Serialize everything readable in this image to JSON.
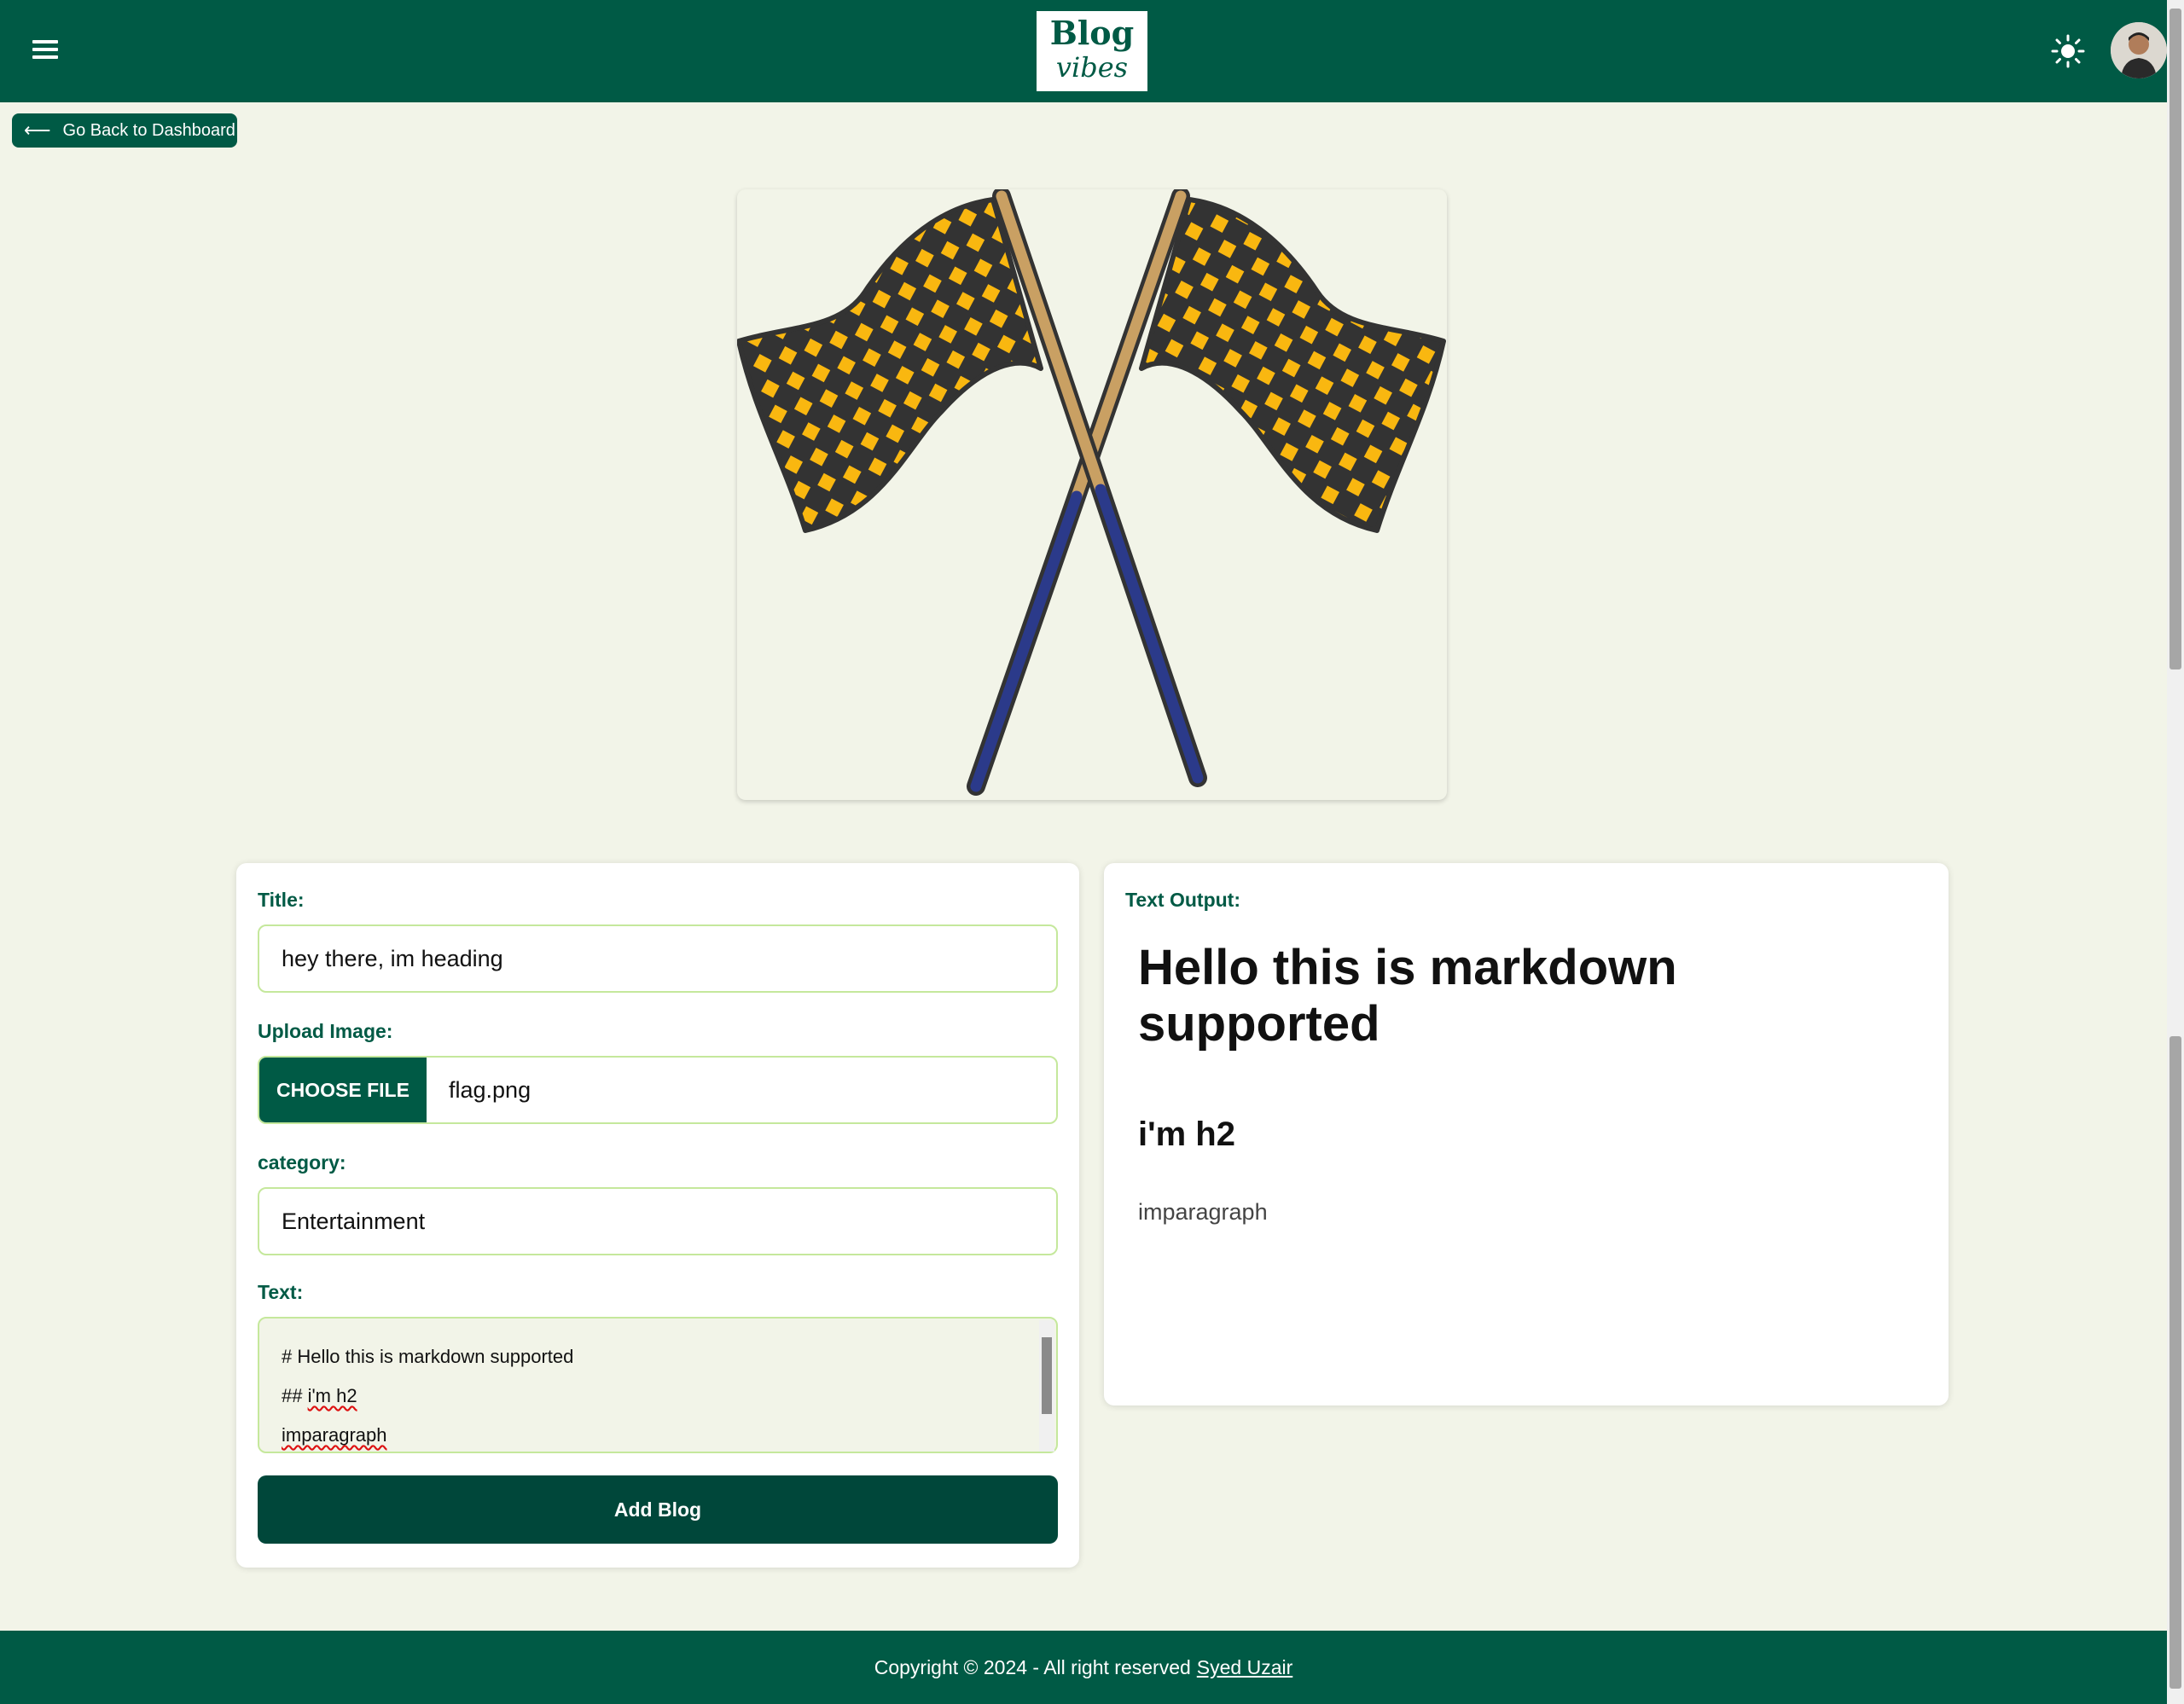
{
  "header": {
    "logo_line1": "Blog",
    "logo_line2": "vibes"
  },
  "nav": {
    "back_label": "Go Back to Dashboard"
  },
  "form": {
    "title_label": "Title:",
    "title_value": "hey there, im heading",
    "upload_label": "Upload Image:",
    "choose_file_label": "CHOOSE FILE",
    "file_name": "flag.png",
    "category_label": "category:",
    "category_value": "Entertainment",
    "text_label": "Text:",
    "text_lines": [
      "# Hello this is markdown supported",
      "## i'm h2",
      "imparagraph"
    ],
    "submit_label": "Add Blog"
  },
  "output": {
    "label": "Text Output:",
    "h1": "Hello this is markdown supported",
    "h2": "i'm h2",
    "paragraph": "imparagraph"
  },
  "footer": {
    "copyright": "Copyright © 2024 - All right reserved",
    "author": "Syed Uzair"
  },
  "colors": {
    "primary": "#005a45",
    "background": "#f2f4e8",
    "field_border": "#c5e89c",
    "flag_yellow": "#f9b710",
    "flag_dark": "#333333",
    "pole_tan": "#c9a063",
    "pole_navy": "#2b3a8a"
  },
  "icons": {
    "menu": "menu-icon",
    "theme": "sun-icon",
    "back": "arrow-left-icon"
  }
}
